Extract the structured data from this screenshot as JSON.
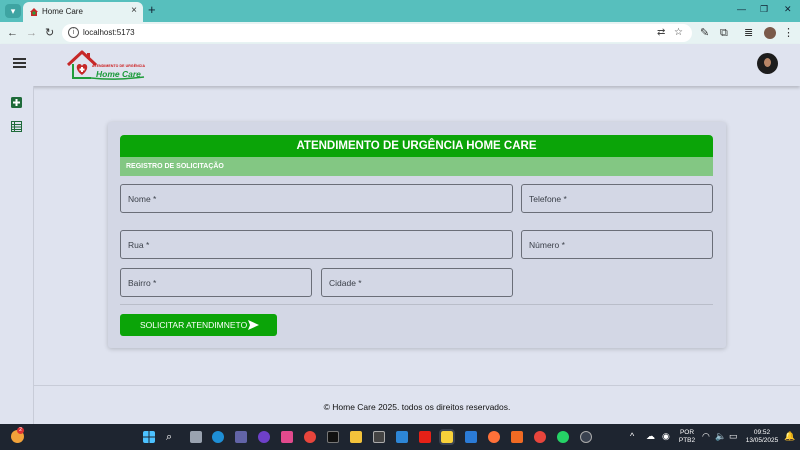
{
  "browser": {
    "tab_title": "Home Care",
    "url": "localhost:5173"
  },
  "header": {
    "logo_small_text": "ATENDIMENTO DE URGÊNCIA",
    "logo_main_text": "Home Care"
  },
  "form": {
    "title": "ATENDIMENTO DE URGÊNCIA HOME CARE",
    "subtitle": "REGISTRO DE SOLICITAÇÃO",
    "fields": {
      "nome": "Nome *",
      "telefone": "Telefone *",
      "rua": "Rua *",
      "numero": "Número *",
      "bairro": "Bairro *",
      "cidade": "Cidade *"
    },
    "submit_label": "SOLICITAR ATENDIMNETO"
  },
  "footer": {
    "text": "© Home Care 2025. todos os direitos reservados."
  },
  "taskbar": {
    "weather_badge": "2",
    "language_line1": "POR",
    "language_line2": "PTB2",
    "time": "09:52",
    "date": "13/05/2025"
  },
  "colors": {
    "accent_green": "#0ba408",
    "subheader_green": "#83c783",
    "tab_strip": "#57bfbd",
    "page_bg": "#dfe3ef"
  }
}
